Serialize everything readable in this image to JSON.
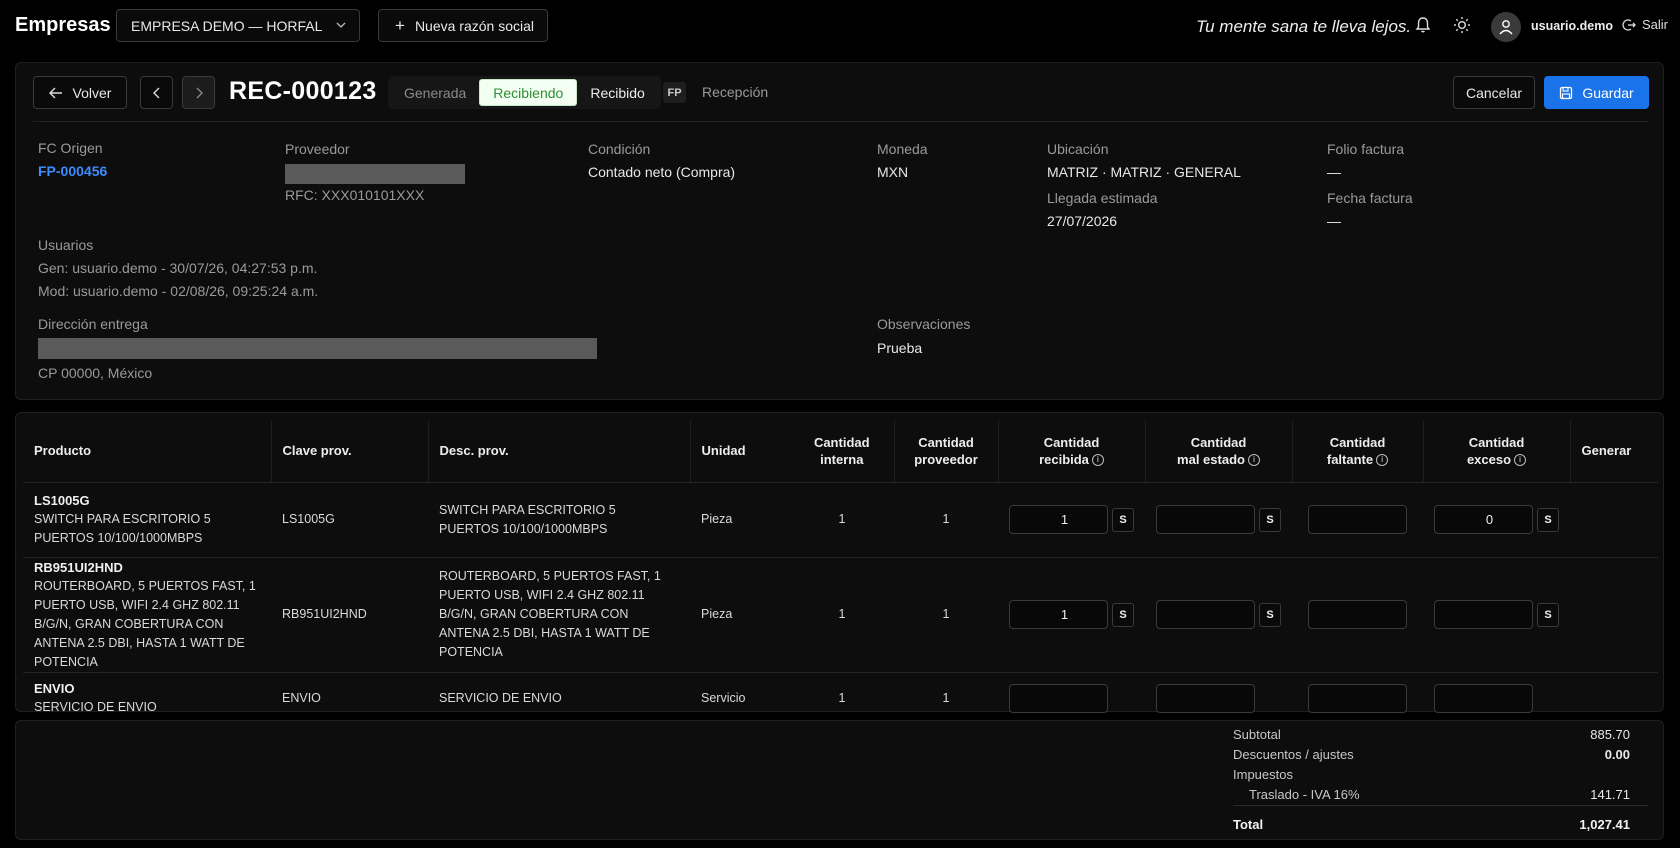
{
  "app": {
    "brand": "Empresas",
    "company": "EMPRESA DEMO — HORFAL",
    "new_company_button": "Nueva razón social",
    "tagline": "Tu mente sana te lleva lejos.",
    "username": "usuario.demo",
    "logout": "Salir"
  },
  "toolbar": {
    "back": "Volver",
    "doc_id": "REC-000123",
    "statuses": [
      "Generada",
      "Recibiendo",
      "Recibido"
    ],
    "active_status": "Recibiendo",
    "type_badge": "FP",
    "type_label": "Recepción",
    "cancel": "Cancelar",
    "save": "Guardar"
  },
  "header": {
    "fc_origen_label": "FC Origen",
    "fc_origen": "FP-000456",
    "proveedor_label": "Proveedor",
    "rfc": "RFC: XXX010101XXX",
    "condicion_label": "Condición",
    "condicion": "Contado neto (Compra)",
    "moneda_label": "Moneda",
    "moneda": "MXN",
    "ubicacion_label": "Ubicación",
    "ubicacion": "MATRIZ · MATRIZ · GENERAL",
    "llegada_label": "Llegada estimada",
    "llegada": "27/07/2026",
    "folio_label": "Folio factura",
    "folio": "—",
    "fecha_label": "Fecha factura",
    "fecha": "—",
    "usuarios_label": "Usuarios",
    "gen": "Gen: usuario.demo - 30/07/26, 04:27:53 p.m.",
    "mod": "Mod: usuario.demo - 02/08/26, 09:25:24 a.m.",
    "direccion_label": "Dirección entrega",
    "cp": "CP 00000, México",
    "observaciones_label": "Observaciones",
    "observaciones": "Prueba"
  },
  "table": {
    "columns": {
      "producto": "Producto",
      "clave": "Clave prov.",
      "desc": "Desc. prov.",
      "unidad": "Unidad",
      "interna": [
        "Cantidad",
        "interna"
      ],
      "proveedor": [
        "Cantidad",
        "proveedor"
      ],
      "recibida": [
        "Cantidad",
        "recibida"
      ],
      "mal_estado": [
        "Cantidad",
        "mal estado"
      ],
      "faltante": [
        "Cantidad",
        "faltante"
      ],
      "exceso": [
        "Cantidad",
        "exceso"
      ],
      "generar": "Generar"
    },
    "info_glyph": "i",
    "s_label": "S",
    "rows": [
      {
        "code": "LS1005G",
        "name": "SWITCH PARA ESCRITORIO 5 PUERTOS 10/100/1000MBPS",
        "clave": "LS1005G",
        "desc": "SWITCH PARA ESCRITORIO 5 PUERTOS 10/100/1000MBPS",
        "unidad": "Pieza",
        "interna": "1",
        "proveedor": "1",
        "recibida": "1",
        "mal_estado": "",
        "faltante": "",
        "exceso": "0"
      },
      {
        "code": "RB951UI2HND",
        "name": "ROUTERBOARD, 5 PUERTOS FAST, 1 PUERTO USB, WIFI 2.4 GHZ 802.11 B/G/N, GRAN COBERTURA CON ANTENA 2.5 DBI, HASTA 1 WATT DE POTENCIA",
        "clave": "RB951UI2HND",
        "desc": "ROUTERBOARD, 5 PUERTOS FAST, 1 PUERTO USB, WIFI 2.4 GHZ 802.11 B/G/N, GRAN COBERTURA CON ANTENA 2.5 DBI, HASTA 1 WATT DE POTENCIA",
        "unidad": "Pieza",
        "interna": "1",
        "proveedor": "1",
        "recibida": "1",
        "mal_estado": "",
        "faltante": "",
        "exceso": ""
      },
      {
        "code": "ENVIO",
        "name": "SERVICIO DE ENVIO",
        "clave": "ENVIO",
        "desc": "SERVICIO DE ENVIO",
        "unidad": "Servicio",
        "interna": "1",
        "proveedor": "1",
        "recibida": "",
        "mal_estado": "",
        "faltante": "",
        "exceso": ""
      }
    ]
  },
  "totals": {
    "subtotal_label": "Subtotal",
    "subtotal": "885.70",
    "descuentos_label": "Descuentos / ajustes",
    "descuentos": "0.00",
    "impuestos_label": "Impuestos",
    "iva_label": "Traslado - IVA 16%",
    "iva": "141.71",
    "total_label": "Total",
    "total": "1,027.41"
  }
}
